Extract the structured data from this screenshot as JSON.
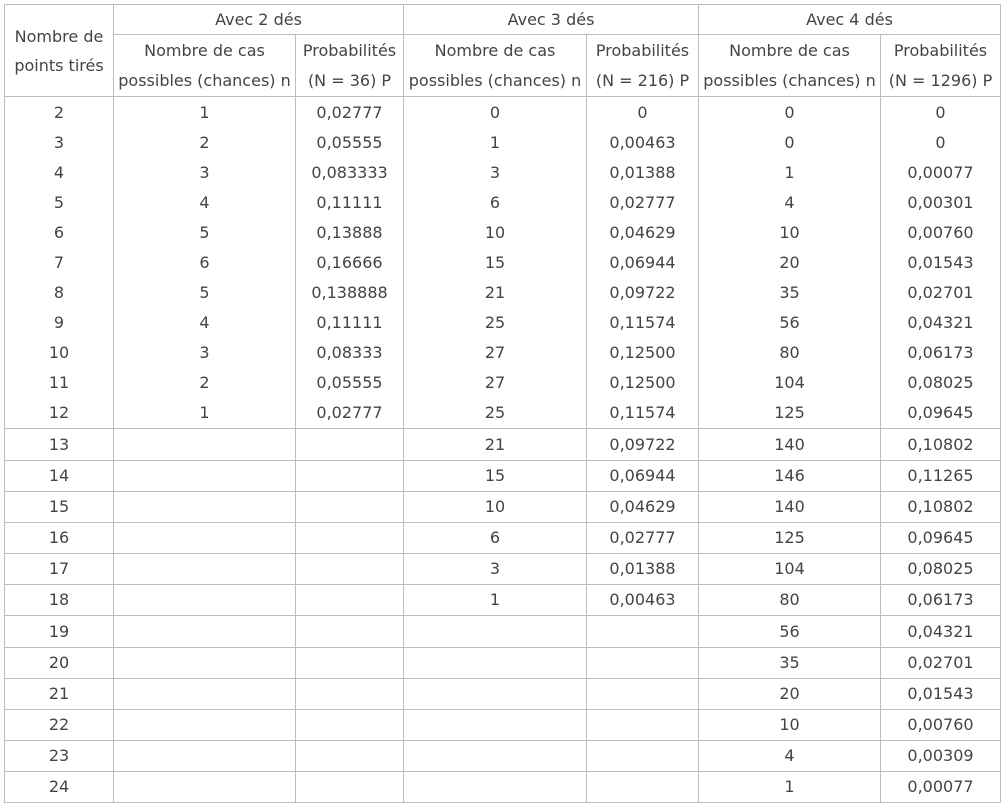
{
  "table": {
    "row_header": "Nombre de points tirés",
    "groups": [
      "Avec 2 dés",
      "Avec 3 dés",
      "Avec 4 dés"
    ],
    "subheaders": [
      "Nombre de cas possibles (chances) n",
      "Probabilités (N = 36) P",
      "Nombre de cas possibles (chances) n",
      "Probabilités (N = 216) P",
      "Nombre de cas possibles (chances) n",
      "Probabilités (N = 1296) P"
    ],
    "sections": [
      [
        [
          "2",
          "1",
          "0,02777",
          "0",
          "0",
          "0",
          "0"
        ],
        [
          "3",
          "2",
          "0,05555",
          "1",
          "0,00463",
          "0",
          "0"
        ],
        [
          "4",
          "3",
          "0,083333",
          "3",
          "0,01388",
          "1",
          "0,00077"
        ],
        [
          "5",
          "4",
          "0,11111",
          "6",
          "0,02777",
          "4",
          "0,00301"
        ],
        [
          "6",
          "5",
          "0,13888",
          "10",
          "0,04629",
          "10",
          "0,00760"
        ],
        [
          "7",
          "6",
          "0,16666",
          "15",
          "0,06944",
          "20",
          "0,01543"
        ],
        [
          "8",
          "5",
          "0,138888",
          "21",
          "0,09722",
          "35",
          "0,02701"
        ],
        [
          "9",
          "4",
          "0,11111",
          "25",
          "0,11574",
          "56",
          "0,04321"
        ],
        [
          "10",
          "3",
          "0,08333",
          "27",
          "0,12500",
          "80",
          "0,06173"
        ],
        [
          "11",
          "2",
          "0,05555",
          "27",
          "0,12500",
          "104",
          "0,08025"
        ],
        [
          "12",
          "1",
          "0,02777",
          "25",
          "0,11574",
          "125",
          "0,09645"
        ]
      ],
      [
        [
          "13",
          "",
          "",
          "21",
          "0,09722",
          "140",
          "0,10802"
        ],
        [
          "14",
          "",
          "",
          "15",
          "0,06944",
          "146",
          "0,11265"
        ],
        [
          "15",
          "",
          "",
          "10",
          "0,04629",
          "140",
          "0,10802"
        ],
        [
          "16",
          "",
          "",
          "6",
          "0,02777",
          "125",
          "0,09645"
        ],
        [
          "17",
          "",
          "",
          "3",
          "0,01388",
          "104",
          "0,08025"
        ],
        [
          "18",
          "",
          "",
          "1",
          "0,00463",
          "80",
          "0,06173"
        ]
      ],
      [
        [
          "19",
          "",
          "",
          "",
          "",
          "56",
          "0,04321"
        ],
        [
          "20",
          "",
          "",
          "",
          "",
          "35",
          "0,02701"
        ],
        [
          "21",
          "",
          "",
          "",
          "",
          "20",
          "0,01543"
        ],
        [
          "22",
          "",
          "",
          "",
          "",
          "10",
          "0,00760"
        ],
        [
          "23",
          "",
          "",
          "",
          "",
          "4",
          "0,00309"
        ],
        [
          "24",
          "",
          "",
          "",
          "",
          "1",
          "0,00077"
        ]
      ]
    ]
  }
}
